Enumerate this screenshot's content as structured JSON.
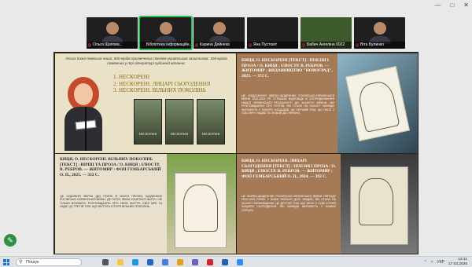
{
  "window": {
    "controls": [
      "minimize",
      "maximize",
      "close"
    ]
  },
  "participants": [
    {
      "name": "Ольга Щапова...",
      "active": false,
      "muted": true,
      "face": true
    },
    {
      "name": "Бібліотека інформаційн...",
      "active": true,
      "muted": false,
      "face": true
    },
    {
      "name": "Карина Дейнека",
      "active": false,
      "muted": true,
      "face": true
    },
    {
      "name": "Яна Пустовіт",
      "active": false,
      "muted": true,
      "face": false
    },
    {
      "name": "Бабич Ангеліна 0022",
      "active": false,
      "muted": true,
      "face": false
    },
    {
      "name": "Віта Булинко",
      "active": false,
      "muted": true,
      "face": true
    }
  ],
  "slide1": {
    "intro": "Ольга Кижа повеська наша, 600 юрідв присвячених поезіям українським захисникам. 108 юріків помежних у трі літературі художній вітання.",
    "list": [
      "1. НЕСКОРЕНІ",
      "2. НЕСКОРЕНІ. ЛИЦАРІ СЬОГОДЕННЯ",
      "3. НЕСКОРЕНІ. ВІЛЬНИХ ПОКОЛІНЬ"
    ],
    "covers": [
      "НЕСКОРЕНІ",
      "НЕСКОРЕНІ",
      "НЕСКОРЕНІ"
    ]
  },
  "slide2": {
    "ref": "КИЦЯ, О. НЕСКОРЕНІ [ТЕКСТ] : ПОЕЗІЯ І ПРОЗА / О. КИЦЯ ; ІЛЮСТР. В. РЕБРОВ. — ЖИТОМИР : ВИДАВНИЦТВО \"НОВОГРАД\", 2023. — 372 С.",
    "desc": "ЦЕ СВІДОЧЕННЯ ЗВІРИХ-ЩОДЕННИК РОСІЙСЬКО-УКРАЇНСЬКОЇ ВІЙНИ 2022-2023 РР. СТРАШНА ВІДПОВІДЬ Й УПОРЯДКУВАННЯ НАШОЇ УКРАЇНСЬКОЇ РЕАЛЬНОСТІ ДО ЗАХИСТУ КРАЇНИ. МИ РОЗПОВІДАЄМО ПРО ГЕРОЇВ, ЯКІ СТАЛИ НА ЗАХИСТ ЗАВЖДИ ЖИТИМУТЬ У ПАМ'ЯТІ НАЩАДКІВ. ЦЕ ПЕРШИЙ ТОМ, ЩО НЕСЕ У СОБІ ВІРУ, НАДІЮ ТА ЛЮБОВ ДО УКРАЇНИ."
  },
  "slide3": {
    "ref": "КИЦЯ, О. НЕСКОРЕНІ. ВІЛЬНИХ ПОКОЛІНЬ [ТЕКСТ] : ВІРШІ ТА ПРОЗА / О. КИЦЯ ; ІЛЮСТР. В. РЕБРОВ. — ЖИТОМИР : ФОП ГЕМБАРСЬКИЙ О. П., 2025. — 332 С.",
    "desc": "ЦЕ ХУДОЖНЯ ЗБІРКА (ДО ПОЕЗІЇ Й МАЛОЇ ПРОЗИ), ЩОДЕННИК РОСІЙСЬКО-УКРАЇНСЬКОЇ ВІЙНИ, ДЕ ГЕРОЇ, ЯКИМ ХОЧЕТЬСЯ ЖИТИ І НЕ ТІЛЬКИ ВОЮВАТИ, РОЗПОВІДАЮТЬ ПРО СВОЄ ЖИТТЯ, СВОЇ МРІЇ ТА НАДІЇ. ЦЕ ТРЕТІЙ ТОМ, ЩО МІСТИТЬ ІСТОРІЇ ВІЛЬНИХ ПОКОЛІНЬ."
  },
  "slide4": {
    "ref": "КИЦЯ, О. НЕСКОРЕНІ. ЛИЦАРІ СЬОГОДЕННЯ [ТЕКСТ] : ПОЕЗІЯ І ПРОЗА / О. КИЦЯ ; ІЛЮСТР. В. РЕБРОВ. — ЖИТОМИР : ФОП ГЕМБАРСЬКИЙ О. П., 2024. — 392 С.",
    "desc": "ЦЕ ЗБІРКА-ЩОДЕННИК РОСІЙСЬКО-УКРАЇНСЬКОЇ ВІЙНИ ПЕРІОДУ 2022-2024 РОКІВ. У КНИЗІ ЗІБРАНО ДОЛІ ЛЮДЕЙ, ЯКІ СТАЛИ НА ЗАХИСТ БАТЬКІВЩИНИ. ЦЕ ДРУГИЙ ТОМ, ЩО НЕСЕ У СОБІ ІСТОРІЇ ЛИЦАРІВ СЬОГОДЕННЯ, ЯКІ ЗАВЖДИ ЖИТИМУТЬ У НАШИХ СЕРЦЯХ."
  },
  "taskbar": {
    "search_placeholder": "Пошук",
    "lang": "УКР",
    "time": "12:11",
    "date": "17.03.2026"
  },
  "colors": {
    "active_tile": "#2fbf5a",
    "accent_gold": "#8b6a15"
  }
}
